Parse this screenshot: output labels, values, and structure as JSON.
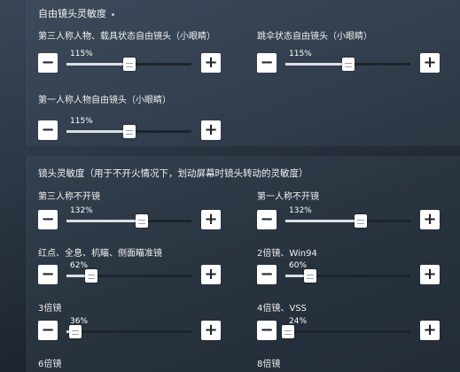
{
  "free_look": {
    "title": "自由镜头灵敏度",
    "sliders": [
      {
        "label": "第三人称人物、载具状态自由镜头（小眼睛）",
        "value": "115%",
        "fraction": 0.5
      },
      {
        "label": "跳伞状态自由镜头（小眼睛）",
        "value": "115%",
        "fraction": 0.5
      },
      {
        "label": "第一人称人物自由镜头（小眼睛）",
        "value": "115%",
        "fraction": 0.5
      }
    ]
  },
  "camera": {
    "title": "镜头灵敏度（用于不开火情况下，划动屏幕时镜头转动的灵敏度）",
    "sliders": [
      {
        "label": "第三人称不开镜",
        "value": "132%",
        "fraction": 0.6
      },
      {
        "label": "第一人称不开镜",
        "value": "132%",
        "fraction": 0.6
      },
      {
        "label": "红点、全息、机瞄、侧面瞄准镜",
        "value": "62%",
        "fraction": 0.2
      },
      {
        "label": "2倍镜、Win94",
        "value": "60%",
        "fraction": 0.2
      },
      {
        "label": "3倍镜",
        "value": "36%",
        "fraction": 0.07
      },
      {
        "label": "4倍镜、VSS",
        "value": "24%",
        "fraction": 0.02
      },
      {
        "label": "6倍镜",
        "value": "",
        "fraction": null
      },
      {
        "label": "8倍镜",
        "value": "",
        "fraction": null
      }
    ]
  },
  "icons": {
    "minus": "−",
    "plus": "+"
  }
}
